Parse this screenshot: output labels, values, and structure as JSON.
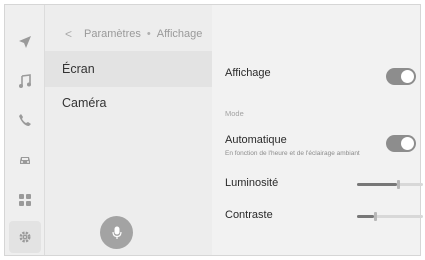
{
  "breadcrumb": {
    "back": "<",
    "parent": "Paramètres",
    "separator": "•",
    "current": "Affichage"
  },
  "menu": [
    {
      "label": "Écran",
      "selected": true
    },
    {
      "label": "Caméra",
      "selected": false
    }
  ],
  "rail": {
    "icons": [
      "navigation-icon",
      "music-icon",
      "phone-icon",
      "car-icon",
      "apps-icon",
      "settings-icon"
    ]
  },
  "settings": {
    "display": {
      "label": "Affichage",
      "toggle_on": true
    },
    "mode_section": "Mode",
    "automatic": {
      "label": "Automatique",
      "sublabel": "En fonction de l'heure et de l'éclairage ambiant",
      "toggle_on": true
    },
    "brightness": {
      "label": "Luminosité",
      "level": 0.6
    },
    "contrast": {
      "label": "Contraste",
      "level": 0.25
    }
  },
  "colors": {
    "toggle_on": "#8d8d8d",
    "panel": "#f2f2f2",
    "selected": "#e3e3e3"
  }
}
